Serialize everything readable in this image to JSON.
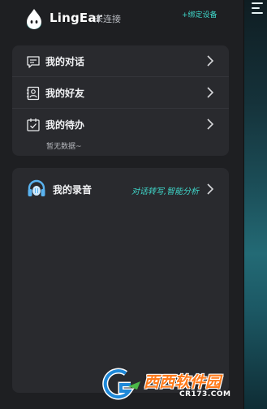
{
  "header": {
    "app_name": "LingEar",
    "connection_status": "未连接",
    "bind_device_label": "+绑定设备"
  },
  "menu": {
    "items": [
      {
        "label": "我的对话",
        "icon": "chat-icon"
      },
      {
        "label": "我的好友",
        "icon": "contact-icon"
      },
      {
        "label": "我的待办",
        "icon": "todo-icon"
      }
    ],
    "empty_hint": "暂无数据~"
  },
  "recordings": {
    "title": "我的录音",
    "subtitle": "对话转写,智能分析",
    "icon": "headphones-icon"
  },
  "watermark": {
    "name": "西西软件园",
    "url": "CR173.COM"
  },
  "colors": {
    "accent": "#3fd6c9",
    "background": "#1e1f22",
    "card": "#292a2e"
  }
}
